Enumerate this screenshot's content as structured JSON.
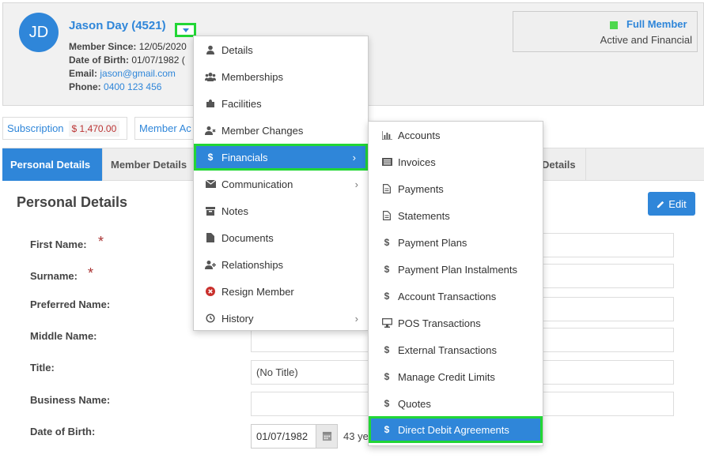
{
  "member": {
    "initials": "JD",
    "name": "Jason Day (4521)",
    "member_since_label": "Member Since:",
    "member_since": "12/05/2020",
    "dob_label": "Date of Birth:",
    "dob": "01/07/1982 (",
    "email_label": "Email:",
    "email": "jason@gmail.com",
    "phone_label": "Phone:",
    "phone": "0400 123 456"
  },
  "status": {
    "title": "Full Member",
    "subtitle": "Active and Financial",
    "color": "#4ed84e"
  },
  "subscription": {
    "label": "Subscription",
    "amount": "$ 1,470.00",
    "member_ac_label": "Member Ac"
  },
  "tabs": [
    {
      "label": "Personal Details"
    },
    {
      "label": "Member Details"
    },
    {
      "label": "Details"
    }
  ],
  "section": {
    "title": "Personal Details",
    "edit_label": "Edit"
  },
  "fields": [
    {
      "label": "First Name:",
      "value": ""
    },
    {
      "label": "Surname:",
      "value": ""
    },
    {
      "label": "Preferred Name:",
      "value": ""
    },
    {
      "label": "Middle Name:",
      "value": ""
    },
    {
      "label": "Title:",
      "value": "(No Title)"
    },
    {
      "label": "Business Name:",
      "value": ""
    },
    {
      "label": "Date of Birth:",
      "value": "01/07/1982"
    }
  ],
  "age_text": "43 ye",
  "menu1": [
    {
      "label": "Details",
      "icon": "user-icon"
    },
    {
      "label": "Memberships",
      "icon": "users-icon"
    },
    {
      "label": "Facilities",
      "icon": "puzzle-icon"
    },
    {
      "label": "Member Changes",
      "icon": "user-times-icon"
    },
    {
      "label": "Financials",
      "icon": "dollar-icon"
    },
    {
      "label": "Communication",
      "icon": "envelope-icon"
    },
    {
      "label": "Notes",
      "icon": "archive-icon"
    },
    {
      "label": "Documents",
      "icon": "file-icon"
    },
    {
      "label": "Relationships",
      "icon": "user-plus-icon"
    },
    {
      "label": "Resign Member",
      "icon": "times-circle-icon"
    },
    {
      "label": "History",
      "icon": "history-icon"
    }
  ],
  "menu2": [
    {
      "label": "Accounts",
      "icon": "bar-chart-icon"
    },
    {
      "label": "Invoices",
      "icon": "list-icon"
    },
    {
      "label": "Payments",
      "icon": "document-icon"
    },
    {
      "label": "Statements",
      "icon": "document-icon"
    },
    {
      "label": "Payment Plans",
      "icon": "dollar-icon"
    },
    {
      "label": "Payment Plan Instalments",
      "icon": "dollar-icon"
    },
    {
      "label": "Account Transactions",
      "icon": "dollar-icon"
    },
    {
      "label": "POS Transactions",
      "icon": "desktop-icon"
    },
    {
      "label": "External Transactions",
      "icon": "dollar-icon"
    },
    {
      "label": "Manage Credit Limits",
      "icon": "dollar-icon"
    },
    {
      "label": "Quotes",
      "icon": "dollar-icon"
    },
    {
      "label": "Direct Debit Agreements",
      "icon": "dollar-icon"
    }
  ]
}
